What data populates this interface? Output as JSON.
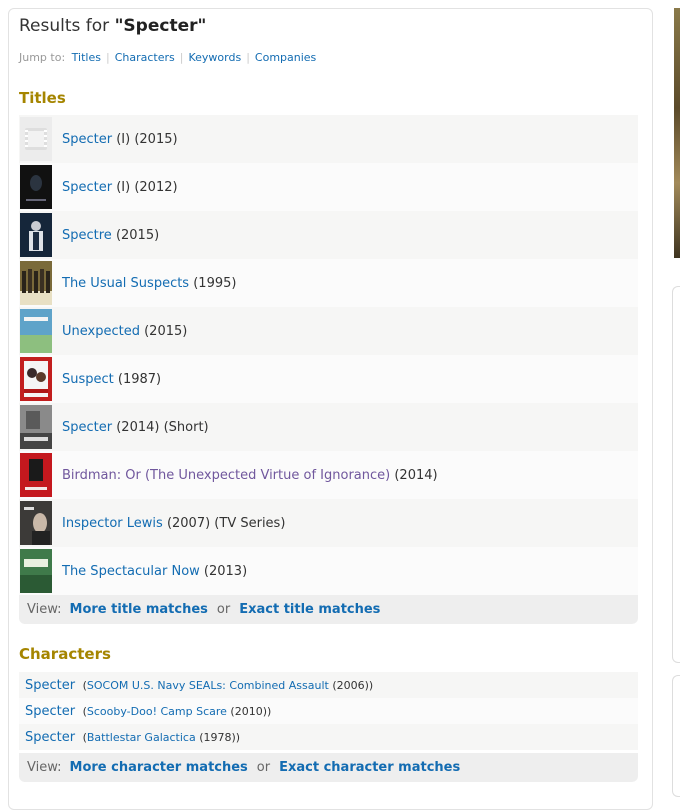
{
  "header": {
    "prefix": "Results for ",
    "query": "\"Specter\""
  },
  "jump": {
    "label": "Jump to:",
    "links": [
      "Titles",
      "Characters",
      "Keywords",
      "Companies"
    ]
  },
  "titles": {
    "heading": "Titles",
    "rows": [
      {
        "name": "Specter",
        "meta": " (I) (2015)",
        "thumb": "placeholder"
      },
      {
        "name": "Specter",
        "meta": " (I) (2012)",
        "thumb": "dark"
      },
      {
        "name": "Spectre",
        "meta": " (2015)",
        "thumb": "navy"
      },
      {
        "name": "The Usual Suspects",
        "meta": " (1995)",
        "thumb": "group"
      },
      {
        "name": "Unexpected",
        "meta": " (2015)",
        "thumb": "blue"
      },
      {
        "name": "Suspect",
        "meta": " (1987)",
        "thumb": "red"
      },
      {
        "name": "Specter",
        "meta": " (2014) (Short)",
        "thumb": "grey"
      },
      {
        "name": "Birdman: Or (The Unexpected Virtue of Ignorance)",
        "meta": " (2014)",
        "thumb": "birdman",
        "visited": true
      },
      {
        "name": "Inspector Lewis",
        "meta": " (2007) (TV Series)",
        "thumb": "lewis"
      },
      {
        "name": "The Spectacular Now",
        "meta": " (2013)",
        "thumb": "green"
      }
    ],
    "view_label": "View:",
    "more": "More title matches",
    "or": "or",
    "exact": "Exact title matches"
  },
  "characters": {
    "heading": "Characters",
    "rows": [
      {
        "name": "Specter",
        "open": " (",
        "title": "SOCOM U.S. Navy SEALs: Combined Assault",
        "year": " (2006))"
      },
      {
        "name": "Specter",
        "open": " (",
        "title": "Scooby-Doo! Camp Scare",
        "year": " (2010))"
      },
      {
        "name": "Specter",
        "open": " (",
        "title": "Battlestar Galactica",
        "year": " (1978))"
      }
    ],
    "view_label": "View:",
    "more": "More character matches",
    "or": "or",
    "exact": "Exact character matches"
  },
  "colors": {
    "link": "#136cb2",
    "visited": "#70579d",
    "section": "#a58500"
  }
}
